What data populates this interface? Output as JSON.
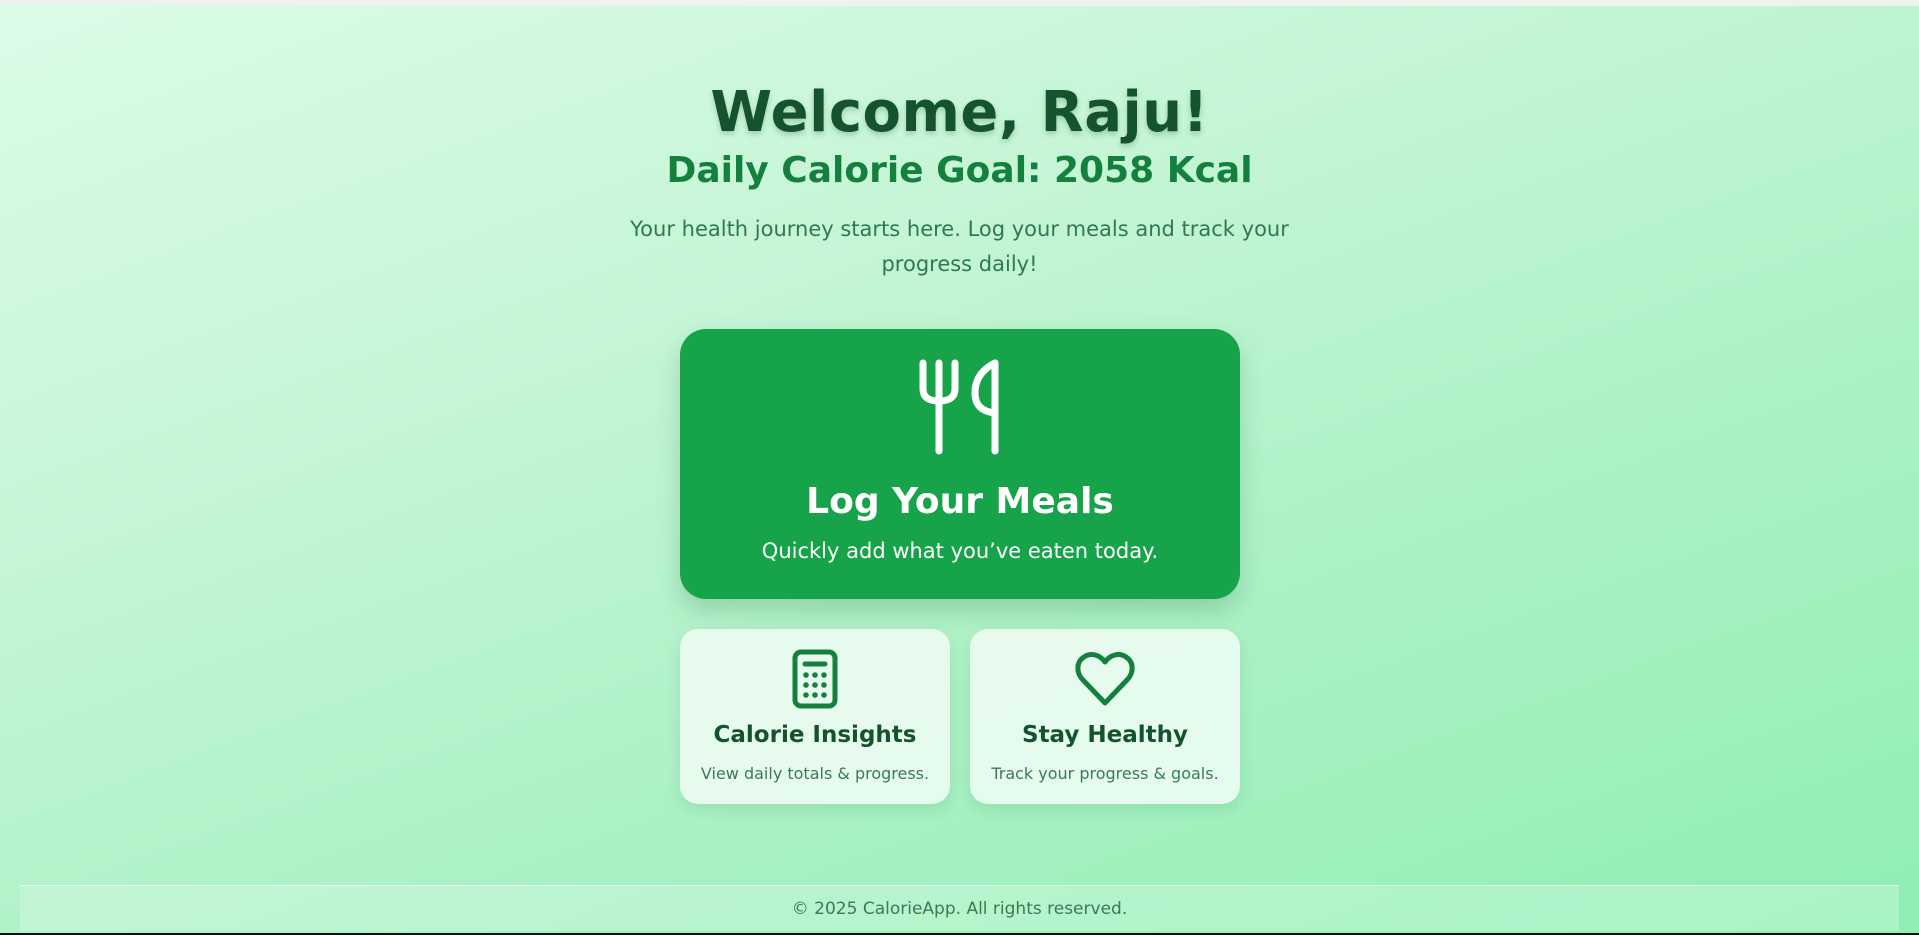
{
  "hero": {
    "welcome": "Welcome, Raju!",
    "goal": "Daily Calorie Goal: 2058 Kcal",
    "tagline": "Your health journey starts here. Log your meals and track your progress daily!"
  },
  "main_card": {
    "icon": "fork-knife-icon",
    "title": "Log Your Meals",
    "subtitle": "Quickly add what you’ve eaten today."
  },
  "cards": [
    {
      "icon": "calculator-icon",
      "title": "Calorie Insights",
      "subtitle": "View daily totals & progress."
    },
    {
      "icon": "heart-icon",
      "title": "Stay Healthy",
      "subtitle": "Track your progress & goals."
    }
  ],
  "footer": {
    "text": "© 2025 CalorieApp. All rights reserved."
  },
  "colors": {
    "primary": "#16a34a",
    "heading": "#14532d",
    "goal": "#15803d",
    "background": "#c4f5d5"
  }
}
